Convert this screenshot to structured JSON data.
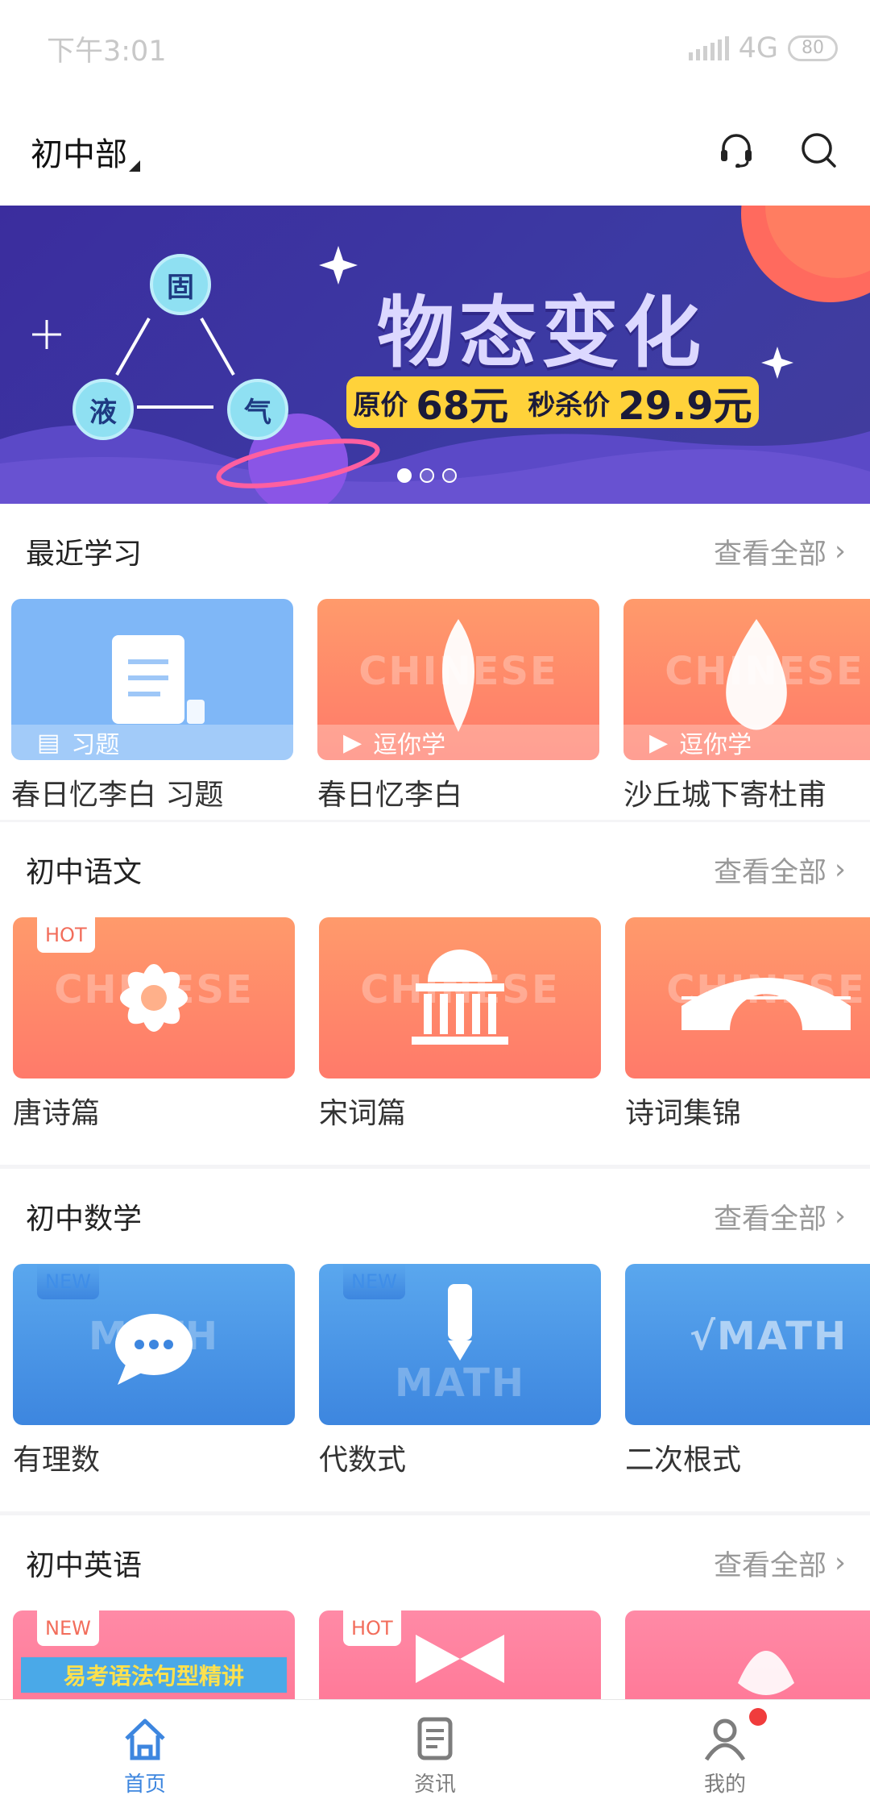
{
  "status": {
    "time": "下午3:01",
    "network": "4G",
    "battery": "80"
  },
  "header": {
    "org_label": "初中部"
  },
  "banner": {
    "title": "物态变化",
    "price_text": "原价",
    "original_price": "68元",
    "sale_text": "秒杀价",
    "sale_price": "29.9元",
    "nodes": [
      "固",
      "液",
      "气"
    ],
    "active_index": 0,
    "slides_count": 3
  },
  "sections": [
    {
      "title": "最近学习",
      "more": "查看全部",
      "cards": [
        {
          "label": "春日忆李白 习题",
          "overlay": "习题",
          "theme": "lightblue"
        },
        {
          "label": "春日忆李白",
          "overlay": "逗你学",
          "watermark": "CHINESE",
          "theme": "orange"
        },
        {
          "label": "沙丘城下寄杜甫",
          "overlay": "逗你学",
          "watermark": "CHINESE",
          "theme": "orange"
        }
      ]
    },
    {
      "title": "初中语文",
      "more": "查看全部",
      "cards": [
        {
          "label": "唐诗篇",
          "badge": "HOT",
          "watermark": "CHINESE",
          "theme": "orange"
        },
        {
          "label": "宋词篇",
          "watermark": "CHINESE",
          "theme": "orange"
        },
        {
          "label": "诗词集锦",
          "watermark": "CHINESE",
          "theme": "orange"
        }
      ]
    },
    {
      "title": "初中数学",
      "more": "查看全部",
      "cards": [
        {
          "label": "有理数",
          "badge": "NEW",
          "watermark": "MATH",
          "theme": "blue"
        },
        {
          "label": "代数式",
          "badge": "NEW",
          "watermark": "MATH",
          "theme": "blue"
        },
        {
          "label": "二次根式",
          "watermark": "√MATH",
          "theme": "blue"
        }
      ]
    },
    {
      "title": "初中英语",
      "more": "查看全部",
      "cards": [
        {
          "badge": "NEW",
          "overlay_title": "易考语法句型精讲",
          "theme": "pink"
        },
        {
          "badge": "HOT",
          "theme": "pink"
        },
        {
          "theme": "pink"
        }
      ]
    }
  ],
  "nav": [
    {
      "label": "首页",
      "active": true
    },
    {
      "label": "资讯"
    },
    {
      "label": "我的",
      "has_dot": true
    }
  ],
  "colors": {
    "accent": "#3d86df",
    "orange": "#ff7a6a",
    "pink": "#ff6d8e",
    "banner": "#3b2d9e",
    "badge_red": "#f03c3c"
  }
}
